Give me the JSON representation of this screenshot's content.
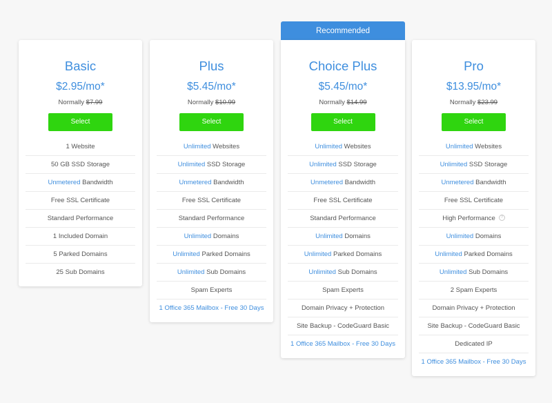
{
  "recommended_label": "Recommended",
  "plans": [
    {
      "name": "Basic",
      "price": "$2.95/mo*",
      "normally_label": "Normally",
      "normally_price": "$7.99",
      "button": "Select",
      "features": [
        {
          "hl": "",
          "text": "1 Website"
        },
        {
          "hl": "",
          "text": "50 GB SSD Storage"
        },
        {
          "hl": "Unmetered",
          "text": " Bandwidth"
        },
        {
          "hl": "",
          "text": "Free SSL Certificate"
        },
        {
          "hl": "",
          "text": "Standard Performance"
        },
        {
          "hl": "",
          "text": "1 Included Domain"
        },
        {
          "hl": "",
          "text": "5 Parked Domains"
        },
        {
          "hl": "",
          "text": "25 Sub Domains"
        }
      ]
    },
    {
      "name": "Plus",
      "price": "$5.45/mo*",
      "normally_label": "Normally",
      "normally_price": "$10.99",
      "button": "Select",
      "features": [
        {
          "hl": "Unlimited",
          "text": " Websites"
        },
        {
          "hl": "Unlimited",
          "text": " SSD Storage"
        },
        {
          "hl": "Unmetered",
          "text": " Bandwidth"
        },
        {
          "hl": "",
          "text": "Free SSL Certificate"
        },
        {
          "hl": "",
          "text": "Standard Performance"
        },
        {
          "hl": "Unlimited",
          "text": " Domains"
        },
        {
          "hl": "Unlimited",
          "text": " Parked Domains"
        },
        {
          "hl": "Unlimited",
          "text": " Sub Domains"
        },
        {
          "hl": "",
          "text": "Spam Experts"
        },
        {
          "link": "1 Office 365 Mailbox - Free 30 Days"
        }
      ]
    },
    {
      "name": "Choice Plus",
      "price": "$5.45/mo*",
      "normally_label": "Normally",
      "normally_price": "$14.99",
      "button": "Select",
      "features": [
        {
          "hl": "Unlimited",
          "text": " Websites"
        },
        {
          "hl": "Unlimited",
          "text": " SSD Storage"
        },
        {
          "hl": "Unmetered",
          "text": " Bandwidth"
        },
        {
          "hl": "",
          "text": "Free SSL Certificate"
        },
        {
          "hl": "",
          "text": "Standard Performance"
        },
        {
          "hl": "Unlimited",
          "text": " Domains"
        },
        {
          "hl": "Unlimited",
          "text": " Parked Domains"
        },
        {
          "hl": "Unlimited",
          "text": " Sub Domains"
        },
        {
          "hl": "",
          "text": "Spam Experts"
        },
        {
          "hl": "",
          "text": "Domain Privacy + Protection"
        },
        {
          "hl": "",
          "text": "Site Backup - CodeGuard Basic"
        },
        {
          "link": "1 Office 365 Mailbox - Free 30 Days"
        }
      ]
    },
    {
      "name": "Pro",
      "price": "$13.95/mo*",
      "normally_label": "Normally",
      "normally_price": "$23.99",
      "button": "Select",
      "features": [
        {
          "hl": "Unlimited",
          "text": " Websites"
        },
        {
          "hl": "Unlimited",
          "text": " SSD Storage"
        },
        {
          "hl": "Unmetered",
          "text": " Bandwidth"
        },
        {
          "hl": "",
          "text": "Free SSL Certificate"
        },
        {
          "hl": "",
          "text": "High Performance",
          "info_icon": "info-icon"
        },
        {
          "hl": "Unlimited",
          "text": " Domains"
        },
        {
          "hl": "Unlimited",
          "text": " Parked Domains"
        },
        {
          "hl": "Unlimited",
          "text": " Sub Domains"
        },
        {
          "hl": "",
          "text": "2 Spam Experts"
        },
        {
          "hl": "",
          "text": "Domain Privacy + Protection"
        },
        {
          "hl": "",
          "text": "Site Backup - CodeGuard Basic"
        },
        {
          "hl": "",
          "text": "Dedicated IP"
        },
        {
          "link": "1 Office 365 Mailbox - Free 30 Days"
        }
      ]
    }
  ],
  "colors": {
    "accent": "#3e8ede",
    "select_button": "#2fd50f",
    "background": "#f7f7f7"
  }
}
